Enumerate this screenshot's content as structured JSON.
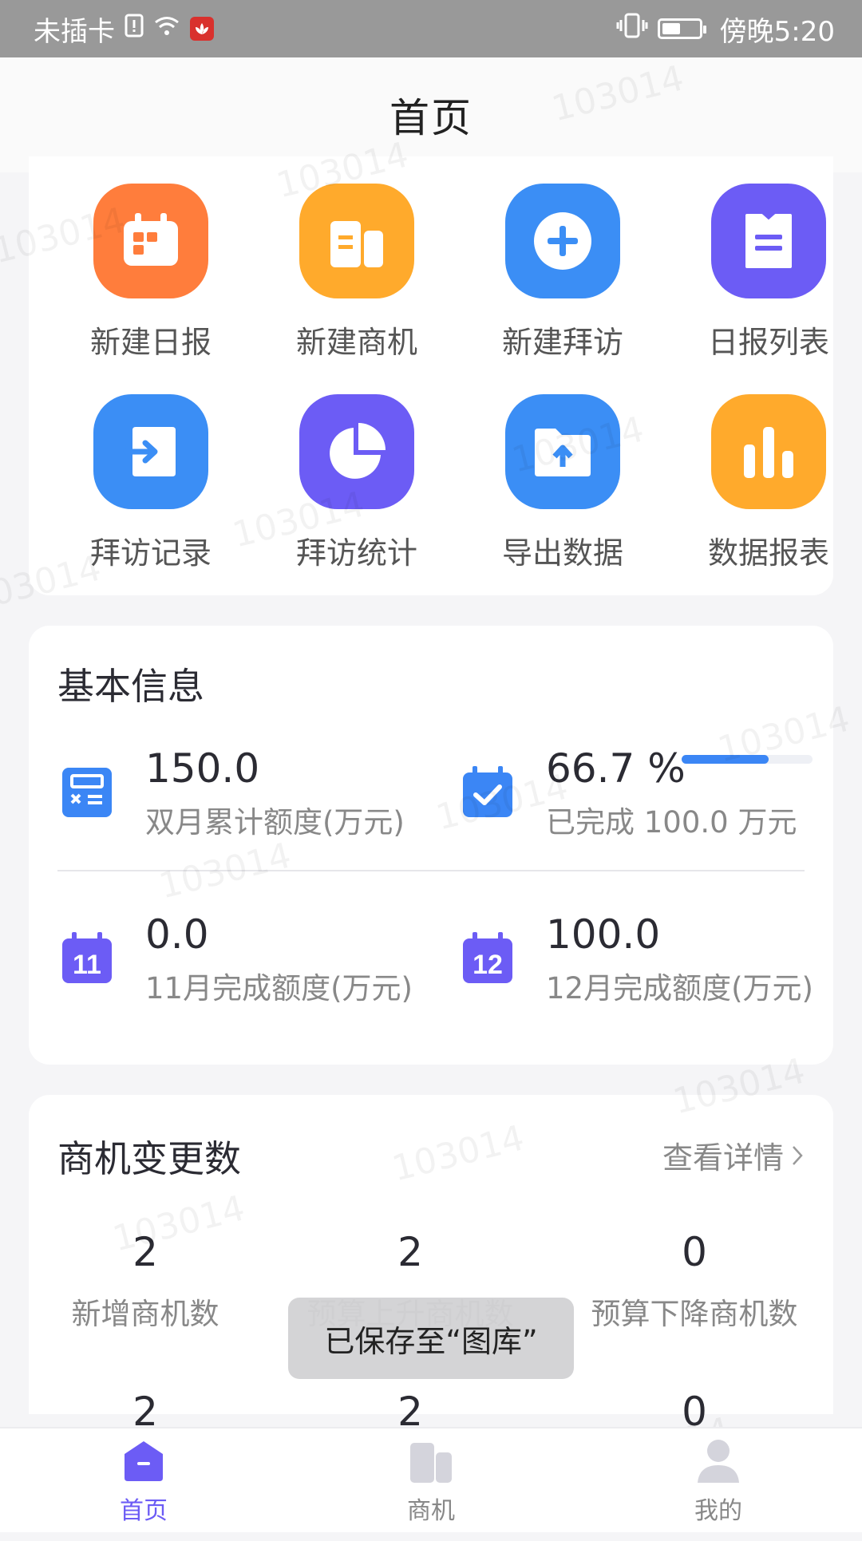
{
  "status_bar": {
    "carrier": "未插卡",
    "time": "傍晚5:20"
  },
  "header": {
    "title": "首页"
  },
  "quick_actions": [
    {
      "label": "新建日报",
      "icon": "calendar-icon",
      "color": "#ff7d3c"
    },
    {
      "label": "新建商机",
      "icon": "building-icon",
      "color": "#ffaa2c"
    },
    {
      "label": "新建拜访",
      "icon": "plus-circle-icon",
      "color": "#3b8ef5"
    },
    {
      "label": "日报列表",
      "icon": "list-document-icon",
      "color": "#6c5cf5"
    },
    {
      "label": "拜访记录",
      "icon": "login-arrow-icon",
      "color": "#3b8ef5"
    },
    {
      "label": "拜访统计",
      "icon": "pie-chart-icon",
      "color": "#6c5cf5"
    },
    {
      "label": "导出数据",
      "icon": "folder-upload-icon",
      "color": "#3b8ef5"
    },
    {
      "label": "数据报表",
      "icon": "bar-chart-icon",
      "color": "#ffaa2c"
    }
  ],
  "basic_info": {
    "title": "基本信息",
    "metrics": [
      {
        "value": "150.0",
        "label": "双月累计额度(万元)",
        "icon": "calculator-icon"
      },
      {
        "value": "66.7 %",
        "label": "已完成 100.0 万元",
        "icon": "calendar-check-icon",
        "progress_percent": 66.7
      },
      {
        "value": "0.0",
        "label": "11月完成额度(万元)",
        "icon": "calendar-11-icon",
        "day": "11"
      },
      {
        "value": "100.0",
        "label": "12月完成额度(万元)",
        "icon": "calendar-12-icon",
        "day": "12"
      }
    ]
  },
  "opportunity_changes": {
    "title": "商机变更数",
    "link_label": "查看详情",
    "stats": [
      {
        "value": "2",
        "label": "新增商机数"
      },
      {
        "value": "2",
        "label": "预算上升商机数"
      },
      {
        "value": "0",
        "label": "预算下降商机数"
      },
      {
        "value": "2"
      },
      {
        "value": "2"
      },
      {
        "value": "0"
      }
    ]
  },
  "toast": {
    "text": "已保存至“图库”"
  },
  "tab_bar": {
    "tabs": [
      {
        "label": "首页",
        "icon": "home-icon",
        "active": true
      },
      {
        "label": "商机",
        "icon": "buildings-icon",
        "active": false
      },
      {
        "label": "我的",
        "icon": "user-icon",
        "active": false
      }
    ]
  },
  "watermark_text": "103014",
  "colors": {
    "accent": "#6c5cf5",
    "blue": "#3b86f5",
    "orange": "#ff7d3c",
    "amber": "#ffaa2c"
  }
}
